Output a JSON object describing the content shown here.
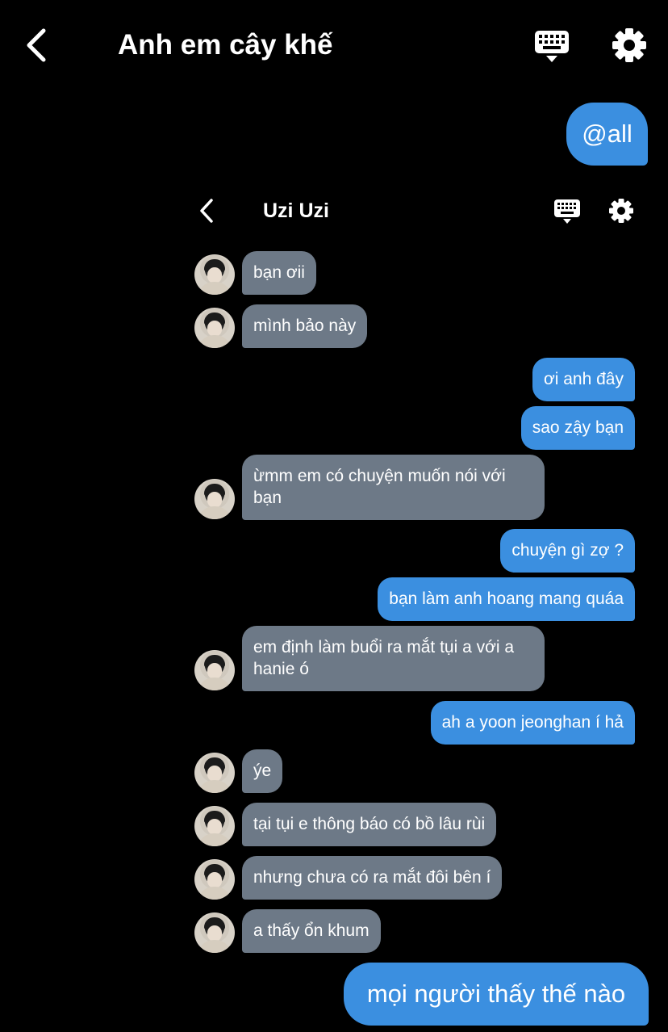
{
  "header": {
    "title": "Anh em cây khế",
    "icons": [
      "back-chevron-icon",
      "keyboard-icon",
      "gear-icon"
    ]
  },
  "first_message": "@all",
  "inner_chat": {
    "title": "Uzi Uzi",
    "messages": [
      {
        "from": "other",
        "text": "bạn ơii"
      },
      {
        "from": "other",
        "text": "mình bảo này"
      },
      {
        "from": "me",
        "text": "ơi anh đây"
      },
      {
        "from": "me",
        "text": "sao zậy bạn"
      },
      {
        "from": "other",
        "text": "ừmm em có chuyện muốn nói với bạn"
      },
      {
        "from": "me",
        "text": "chuyện gì zợ ?"
      },
      {
        "from": "me",
        "text": "bạn làm anh hoang mang quáa"
      },
      {
        "from": "other",
        "text": "em định làm buổi ra mắt tụi a với a hanie ó"
      },
      {
        "from": "me",
        "text": "ah a yoon jeonghan í hả"
      },
      {
        "from": "other",
        "text": "ýe"
      },
      {
        "from": "other",
        "text": "tại tụi e thông báo có bồ lâu rùi"
      },
      {
        "from": "other",
        "text": "nhưng chưa có ra mắt đôi bên í"
      },
      {
        "from": "other",
        "text": "a thấy ổn khum"
      }
    ]
  },
  "last_message": "mọi người thấy thế nào",
  "colors": {
    "background": "#000000",
    "outgoing": "#3b8fe0",
    "incoming": "#6d7987",
    "text": "#ffffff"
  }
}
